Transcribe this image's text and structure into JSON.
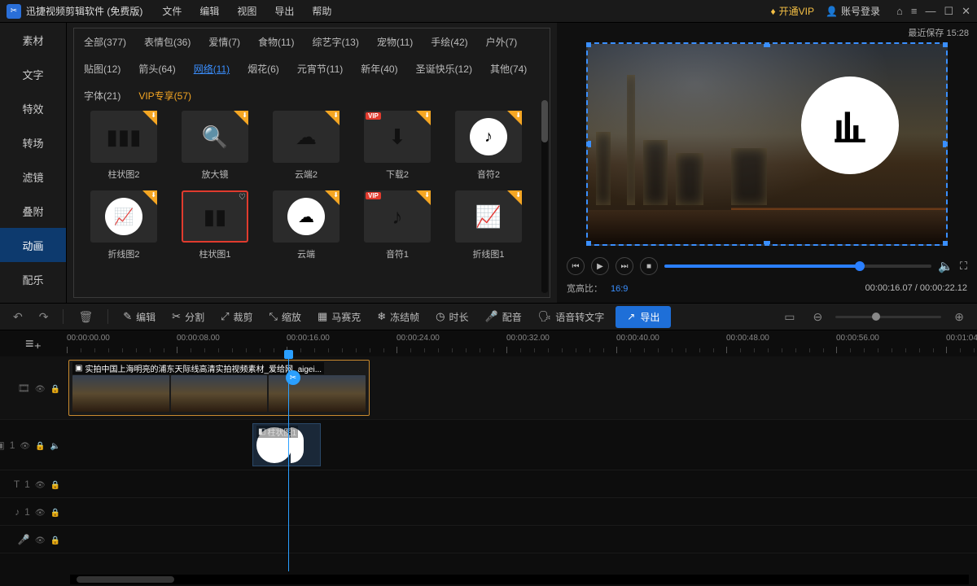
{
  "titlebar": {
    "title": "迅捷视频剪辑软件 (免费版)",
    "menus": [
      "文件",
      "编辑",
      "视图",
      "导出",
      "帮助"
    ],
    "vip": "开通VIP",
    "login": "账号登录"
  },
  "sidebar": {
    "items": [
      "素材",
      "文字",
      "特效",
      "转场",
      "滤镜",
      "叠附",
      "动画",
      "配乐"
    ],
    "active": 6
  },
  "categories": [
    {
      "label": "全部(377)"
    },
    {
      "label": "表情包(36)"
    },
    {
      "label": "爱情(7)"
    },
    {
      "label": "食物(11)"
    },
    {
      "label": "综艺字(13)"
    },
    {
      "label": "宠物(11)"
    },
    {
      "label": "手绘(42)"
    },
    {
      "label": "户外(7)"
    },
    {
      "label": "贴图(12)"
    },
    {
      "label": "箭头(64)"
    },
    {
      "label": "网络(11)",
      "active": true
    },
    {
      "label": "烟花(6)"
    },
    {
      "label": "元宵节(11)"
    },
    {
      "label": "新年(40)"
    },
    {
      "label": "圣诞快乐(12)"
    },
    {
      "label": "其他(74)"
    },
    {
      "label": "字体(21)"
    },
    {
      "label": "VIP专享(57)",
      "vip": true
    }
  ],
  "assets": [
    {
      "label": "柱状图2",
      "icon": "bar",
      "circle": false,
      "dl": true
    },
    {
      "label": "放大镜",
      "icon": "search",
      "circle": false,
      "dl": true
    },
    {
      "label": "云端2",
      "icon": "cloud",
      "circle": false,
      "dl": true
    },
    {
      "label": "下载2",
      "icon": "download",
      "circle": false,
      "vip": true,
      "dl": true
    },
    {
      "label": "音符2",
      "icon": "note",
      "circle": true,
      "dl": true
    },
    {
      "label": "折线图2",
      "icon": "line",
      "circle": true,
      "dl": true
    },
    {
      "label": "柱状图1",
      "icon": "bar2",
      "circle": false,
      "selected": true,
      "fav": true
    },
    {
      "label": "云端",
      "icon": "cloud",
      "circle": true,
      "dl": true
    },
    {
      "label": "音符1",
      "icon": "note",
      "circle": false,
      "vip": true,
      "dl": true
    },
    {
      "label": "折线图1",
      "icon": "line",
      "circle": false,
      "dl": true
    }
  ],
  "preview": {
    "saved": "最近保存 15:28",
    "ratio_label": "宽高比：",
    "ratio": "16:9",
    "time_cur": "00:00:16.07",
    "time_total": "00:00:22.12"
  },
  "toolbar": {
    "edit": "编辑",
    "split": "分割",
    "crop": "裁剪",
    "scale": "缩放",
    "mosaic": "马赛克",
    "freeze": "冻结帧",
    "duration": "时长",
    "dub": "配音",
    "stt": "语音转文字",
    "export": "导出"
  },
  "timeline": {
    "ticks": [
      "00:00:00.00",
      "00:00:08.00",
      "00:00:16.00",
      "00:00:24.00",
      "00:00:32.00",
      "00:00:40.00",
      "00:00:48.00",
      "00:00:56.00",
      "00:01:04"
    ],
    "clip_title": "实拍中国上海明亮的浦东天际线高清实拍视频素材_爱给网_aigei...",
    "obj_label": "柱状图1"
  }
}
